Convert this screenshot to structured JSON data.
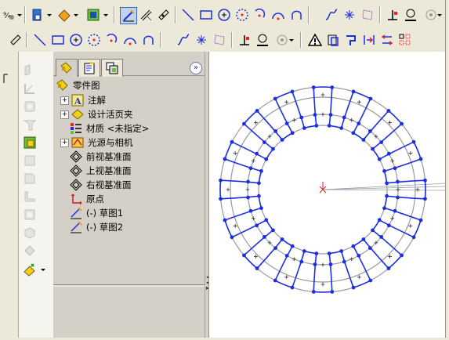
{
  "toolbar_top": {
    "items": [
      "smart-dimension-icon",
      "new-part-icon",
      "save-icon",
      "paint-bucket-icon",
      "rebuild-icon",
      "sketch-icon",
      "smart-dim-icon",
      "tilt-icon",
      "line-icon",
      "rectangle-icon",
      "circle-icon",
      "arc-icon",
      "centerpoint-arc-icon",
      "tangent-arc-icon",
      "threepoint-arc-icon",
      "spline-icon",
      "point-icon",
      "grid-icon",
      "relations-icon",
      "mirror-icon",
      "settings-icon"
    ]
  },
  "toolbar_second": {
    "items": [
      "dimension-icon",
      "line-icon",
      "rectangle-icon",
      "circle-icon",
      "arc-icon",
      "centerpoint-arc-icon",
      "tangent-arc-icon",
      "threepoint-arc-icon",
      "spline-icon",
      "point-icon",
      "grid-icon",
      "relations-icon",
      "mirror-icon",
      "offset-icon",
      "warning-icon",
      "convert-icon",
      "trim-icon",
      "extend-icon",
      "split-icon",
      "pattern-icon"
    ]
  },
  "tree": {
    "tabs": [
      "feature-manager-tab",
      "property-manager-tab",
      "configuration-manager-tab"
    ],
    "root": "零件图",
    "items": [
      {
        "label": "注解",
        "expandable": true,
        "icon": "annotation-icon"
      },
      {
        "label": "设计活页夹",
        "expandable": true,
        "icon": "design-binder-icon"
      },
      {
        "label": "材质 <未指定>",
        "expandable": false,
        "icon": "material-icon"
      },
      {
        "label": "光源与相机",
        "expandable": true,
        "icon": "lights-camera-icon"
      },
      {
        "label": "前视基准面",
        "expandable": false,
        "icon": "plane-icon"
      },
      {
        "label": "上视基准面",
        "expandable": false,
        "icon": "plane-icon"
      },
      {
        "label": "右视基准面",
        "expandable": false,
        "icon": "plane-icon"
      },
      {
        "label": "原点",
        "expandable": false,
        "icon": "origin-icon"
      },
      {
        "label": "(-) 草图1",
        "expandable": false,
        "icon": "sketch-icon"
      },
      {
        "label": "(-) 草图2",
        "expandable": false,
        "icon": "sketch-icon"
      }
    ]
  },
  "sketch": {
    "tooth_count": 16,
    "sketch_color": "#1c2fe0",
    "ring_color": "#999999",
    "origin_color": "#d02020"
  }
}
